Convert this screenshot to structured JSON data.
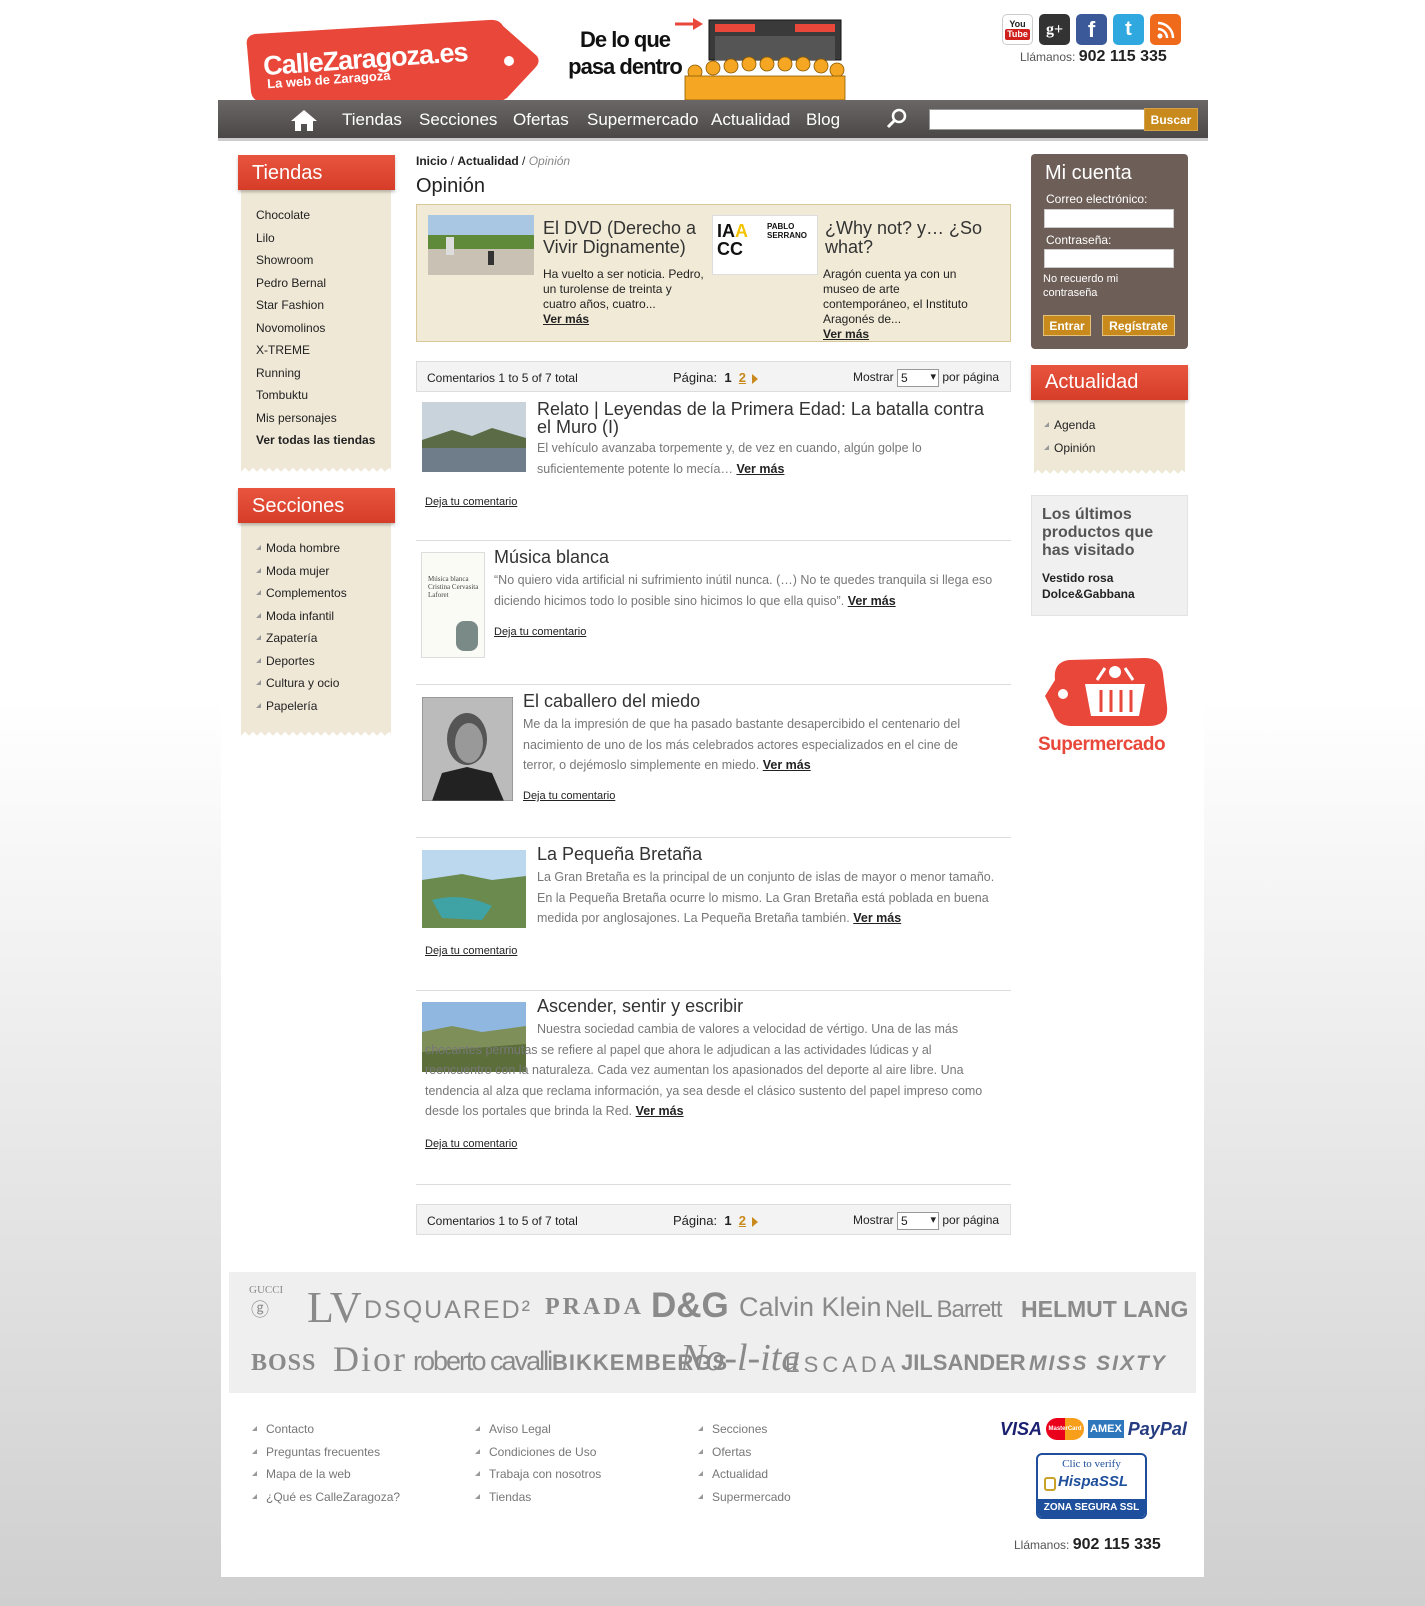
{
  "header": {
    "logo_text": "CalleZaragoza.es",
    "logo_sub": "La web de Zaragoza",
    "tagline": "De lo que pasa dentro",
    "phone_label": "Llámanos:",
    "phone": "902 115 335",
    "social": [
      {
        "name": "youtube-icon",
        "text": "You Tube",
        "color": "#ffffff"
      },
      {
        "name": "googleplus-icon",
        "text": "g+",
        "color": "#333333"
      },
      {
        "name": "facebook-icon",
        "text": "f",
        "color": "#3b5998"
      },
      {
        "name": "twitter-icon",
        "text": "t",
        "color": "#2fa8e0"
      },
      {
        "name": "rss-icon",
        "text": "rss",
        "color": "#f06a1c"
      }
    ]
  },
  "nav": {
    "items": [
      "Tiendas",
      "Secciones",
      "Ofertas",
      "Supermercado",
      "Actualidad",
      "Blog"
    ],
    "search_button": "Buscar"
  },
  "sidebar": {
    "tiendas_title": "Tiendas",
    "tiendas": [
      "Chocolate",
      "Lilo",
      "Showroom",
      "Pedro Bernal",
      "Star Fashion",
      "Novomolinos",
      "X-TREME",
      "Running",
      "Tombuktu",
      "Mis personajes"
    ],
    "tiendas_all": "Ver todas las tiendas",
    "secciones_title": "Secciones",
    "secciones": [
      "Moda hombre",
      "Moda mujer",
      "Complementos",
      "Moda infantil",
      "Zapatería",
      "Deportes",
      "Cultura y ocio",
      "Papelería"
    ]
  },
  "breadcrumb": {
    "home": "Inicio",
    "section": "Actualidad",
    "current": "Opinión"
  },
  "page_title": "Opinión",
  "featured": [
    {
      "title": "El DVD (Derecho a Vivir Dignamente)",
      "text": "Ha vuelto a ser noticia. Pedro, un turolense de treinta y cuatro años, cuatro...",
      "more": "Ver más"
    },
    {
      "title": "¿Why not? y… ¿So what?",
      "text": "Aragón cuenta ya con un museo de arte contemporáneo, el Instituto Aragonés de...",
      "more": "Ver más",
      "logo_text": "IAACC PABLO SERRANO"
    }
  ],
  "pager": {
    "count": "Comentarios 1 to 5 of 7 total",
    "page_label": "Página:",
    "page_current": "1",
    "page_next": "2",
    "show_label": "Mostrar",
    "show_value": "5",
    "per_page": "por página"
  },
  "articles": [
    {
      "title": "Relato | Leyendas de la Primera Edad: La batalla contra el Muro (I)",
      "text": "El vehículo avanzaba torpemente y, de vez en cuando, algún golpe lo suficientemente potente lo mecía…",
      "more": "Ver más",
      "comment": "Deja tu comentario"
    },
    {
      "title": "Música blanca",
      "text": "“No quiero vida artificial ni sufrimiento inútil nunca. (…) No te quedes tranquila si llega eso diciendo hicimos todo lo posible sino hicimos lo que ella quiso”.",
      "more": "Ver más",
      "comment": "Deja tu comentario",
      "book_text": "Música blanca Cristina Cervasita Laforet"
    },
    {
      "title": "El caballero del miedo",
      "text": "Me da la impresión de que ha pasado bastante desapercibido el centenario del nacimiento de uno de los más celebrados actores especializados en el cine de terror, o dejémoslo simplemente en miedo.",
      "more": "Ver más",
      "comment": "Deja tu comentario"
    },
    {
      "title": "La Pequeña Bretaña",
      "text": "La Gran Bretaña es la principal de un conjunto de islas de mayor o menor tamaño. En la Pequeña Bretaña ocurre lo mismo. La Gran Bretaña está poblada en buena medida por anglosajones. La Pequeña Bretaña también.",
      "more": "Ver más",
      "comment": "Deja tu comentario"
    },
    {
      "title": "Ascender, sentir y escribir",
      "text": "Nuestra sociedad cambia de valores a velocidad de vértigo. Una de las más chocantes permutas se refiere al papel que ahora le adjudican a las actividades lúdicas y al reencuentro con la naturaleza. Cada vez aumentan los apasionados del deporte al aire libre. Una tendencia al alza que reclama información, ya sea desde el clásico sustento del papel impreso como desde los portales que brinda la Red.",
      "more": "Ver más",
      "comment": "Deja tu comentario"
    }
  ],
  "account": {
    "title": "Mi cuenta",
    "email_label": "Correo electrónico:",
    "password_label": "Contraseña:",
    "forgot": "No recuerdo mi contraseña",
    "login": "Entrar",
    "register": "Regístrate"
  },
  "actualidad": {
    "title": "Actualidad",
    "items": [
      "Agenda",
      "Opinión"
    ]
  },
  "recent": {
    "title": "Los últimos productos que has visitado",
    "product": "Vestido rosa Dolce&Gabbana"
  },
  "supermarket_label": "Supermercado",
  "brands_row1": [
    "GUCCI",
    "LV",
    "DSQUARED²",
    "PRADA",
    "D&G",
    "Calvin Klein",
    "NeIL Barrett",
    "HELMUT LANG"
  ],
  "brands_row2": [
    "BOSS",
    "Dior",
    "roberto cavalli",
    "BIKKEMBERGS",
    "No-l-ita",
    "ESCADA",
    "JILSANDER",
    "MISS SIXTY"
  ],
  "footer": {
    "col1": [
      "Contacto",
      "Preguntas frecuentes",
      "Mapa de la web",
      "¿Qué es CalleZaragoza?"
    ],
    "col2": [
      "Aviso Legal",
      "Condiciones de Uso",
      "Trabaja con nosotros",
      "Tiendas"
    ],
    "col3": [
      "Secciones",
      "Ofertas",
      "Actualidad",
      "Supermercado"
    ],
    "cards": [
      "VISA",
      "MasterCard",
      "AMEX",
      "PayPal"
    ],
    "ssl_top": "Clic to verify",
    "ssl_mid": "HispaSSL",
    "ssl_bottom": "ZONA SEGURA SSL",
    "phone_label": "Llámanos:",
    "phone": "902 115 335"
  }
}
